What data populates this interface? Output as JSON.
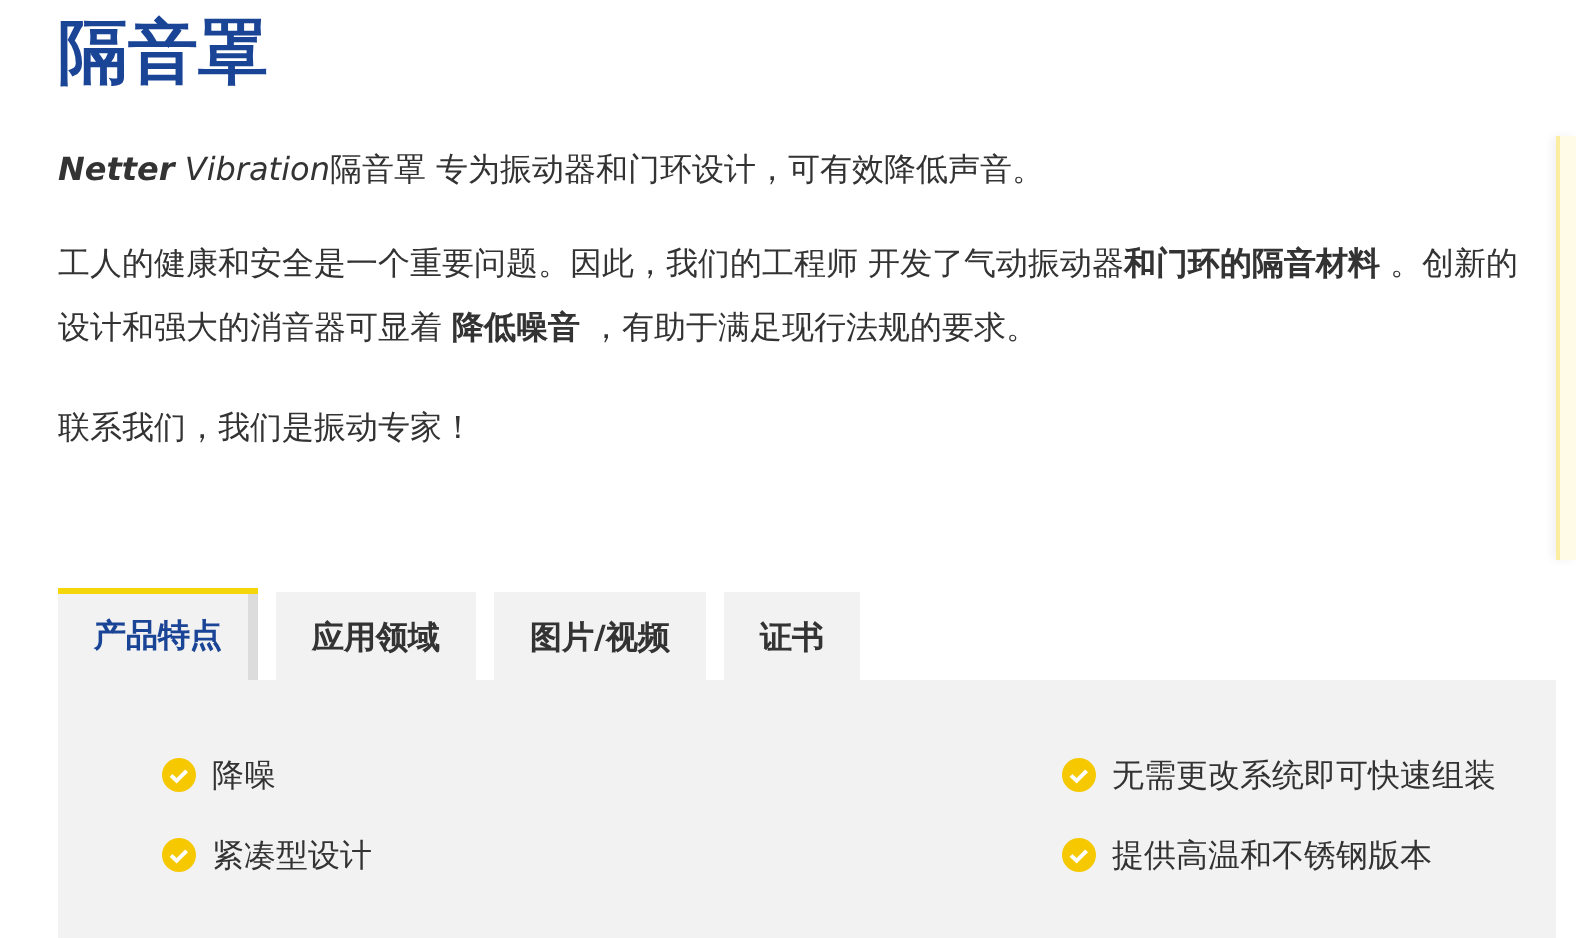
{
  "title": "隔音罩",
  "intro": {
    "brand": "Netter",
    "model": "Vibration",
    "text": "隔音罩  专为振动器和门环设计，可有效降低声音。"
  },
  "paragraphs": [
    "工人的健康和安全是一个重要问题。因此，我们的工程师 开发了气动振动器**和门环的隔音材料** 。创新的设计和强大的消音器可显着 **降低噪音** ，有助于满足现行法规的要求。",
    "联系我们，我们是振动专家！"
  ],
  "tabs": [
    {
      "label": "产品特点",
      "selected": true
    },
    {
      "label": "应用领域",
      "selected": false
    },
    {
      "label": "图片/视频",
      "selected": false
    },
    {
      "label": "证书",
      "selected": false
    }
  ],
  "features": [
    [
      "降噪",
      "紧凑型设计"
    ],
    [
      "无需更改系统即可快速组装",
      "提供高温和不锈钢版本"
    ]
  ]
}
